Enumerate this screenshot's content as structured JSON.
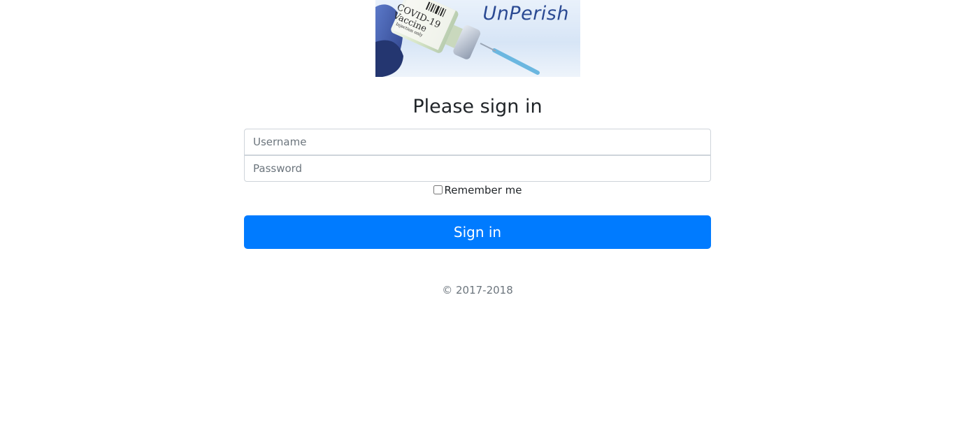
{
  "logo": {
    "brand": "UnPerish",
    "vial_label_line1": "COVID-19",
    "vial_label_line2": "Vaccine",
    "vial_label_small": "Injection only"
  },
  "form": {
    "heading": "Please sign in",
    "username_placeholder": "Username",
    "username_value": "",
    "password_placeholder": "Password",
    "password_value": "",
    "remember_label": "Remember me",
    "remember_checked": false,
    "submit_label": "Sign in"
  },
  "footer": {
    "copyright": "© 2017-2018"
  },
  "colors": {
    "primary": "#007bff",
    "brand_text": "#2b4a93",
    "muted": "#6c757d"
  }
}
